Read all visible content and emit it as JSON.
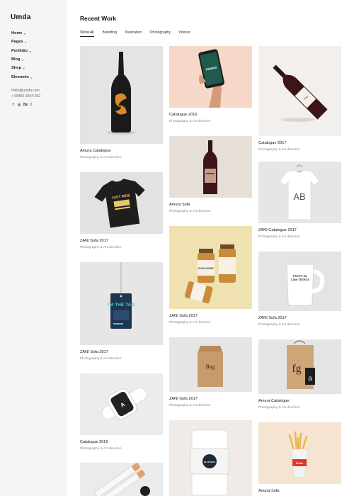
{
  "brand": {
    "logo": "Umda"
  },
  "nav": {
    "items": [
      {
        "label": "Home"
      },
      {
        "label": "Pages"
      },
      {
        "label": "Portfolio"
      },
      {
        "label": "Blog"
      },
      {
        "label": "Shop"
      },
      {
        "label": "Elements"
      }
    ],
    "chevron": "⌄"
  },
  "contact": {
    "email": "Hello@umda.com",
    "phone": "+ 68455-3354-202"
  },
  "social": [
    "f",
    "◎",
    "Be",
    "t"
  ],
  "main": {
    "title": "Recent Work",
    "filters": [
      {
        "label": "Show All",
        "active": true
      },
      {
        "label": "Branding"
      },
      {
        "label": "Illustration"
      },
      {
        "label": "Photography"
      },
      {
        "label": "Interior"
      }
    ]
  },
  "projects": [
    {
      "title": "Amura Catalogue",
      "subtitle": "Photography & Art direction",
      "image": "black-bottle"
    },
    {
      "title": "ZANI Sofa 2017",
      "subtitle": "Photography & Art direction",
      "image": "black-tshirt"
    },
    {
      "title": "ZANI Sofa 2017",
      "subtitle": "Photography & Art direction",
      "image": "hang-tag"
    },
    {
      "title": "Catalogue 2016",
      "subtitle": "Photography & Art direction",
      "image": "smart-watch"
    },
    {
      "title": "",
      "subtitle": "",
      "image": "tubes"
    },
    {
      "title": "Catalogue 2016",
      "subtitle": "Photography & Art direction",
      "image": "phone-hand"
    },
    {
      "title": "Amura Sofa",
      "subtitle": "Photography & Art direction",
      "image": "wine-bottle"
    },
    {
      "title": "ZANI Sofa 2017",
      "subtitle": "Photography & Art direction",
      "image": "jars"
    },
    {
      "title": "ZANI Sofa 2017",
      "subtitle": "Photography & Art direction",
      "image": "paper-bag"
    },
    {
      "title": "",
      "subtitle": "",
      "image": "box"
    },
    {
      "title": "Catalogue 2017",
      "subtitle": "Photography & Art direction",
      "image": "wine-lying"
    },
    {
      "title": "ZANI Catalogue 2017",
      "subtitle": "Photography & Art direction",
      "image": "white-tshirt"
    },
    {
      "title": "ZANI Sofa 2017",
      "subtitle": "Photography & Art direction",
      "image": "mug"
    },
    {
      "title": "Amura Catalogue",
      "subtitle": "Photography & Art direction",
      "image": "kraft-bag"
    },
    {
      "title": "Amura Sofa",
      "subtitle": "Photography & Art direction",
      "image": "fries"
    }
  ],
  "image_text": {
    "phone_brand": "PRIMUS",
    "tshirt_print": "JUST RIDE",
    "tag_text": "I'M THE TAG",
    "watch_logo": "A",
    "jar_label": "GOOD HONEY",
    "bag_text": "Bag",
    "box_label": "BLUE BOX",
    "wine_lying_label": "Vino",
    "tshirt_letters": "AB",
    "mug_text": "ENJOY the Little THINGS",
    "kraft_letters": "fg",
    "kraft_tag": "a",
    "fries_label": "Frites"
  },
  "colors": {
    "sidebar_bg": "#f5f5f5",
    "text": "#111111",
    "muted": "#888888"
  }
}
